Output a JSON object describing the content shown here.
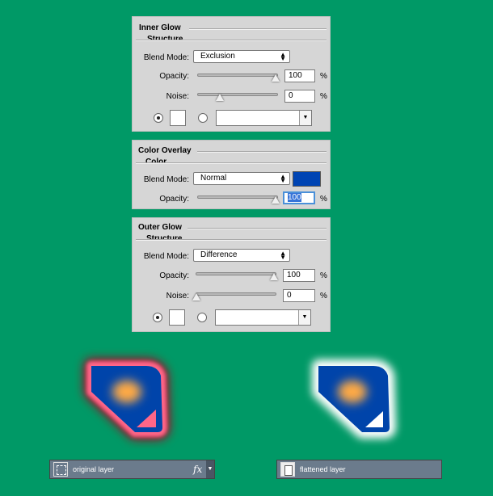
{
  "colors": {
    "background": "#009966",
    "overlay_swatch": "#0044b3",
    "shape_fill": "#0044aa",
    "shape_blob": "#ffaa44",
    "inner_glow_color": "#ffffff",
    "outer_glow_color": "#ffffff",
    "left_glow_pink": "#ff6688",
    "left_glow_dark": "#aa0022"
  },
  "inner_glow": {
    "title": "Inner Glow",
    "section": "Structure",
    "blend_label": "Blend Mode:",
    "blend_value": "Exclusion",
    "opacity_label": "Opacity:",
    "opacity_value": "100",
    "noise_label": "Noise:",
    "noise_value": "0",
    "percent": "%"
  },
  "color_overlay": {
    "title": "Color Overlay",
    "section": "Color",
    "blend_label": "Blend Mode:",
    "blend_value": "Normal",
    "opacity_label": "Opacity:",
    "opacity_value": "100",
    "percent": "%"
  },
  "outer_glow": {
    "title": "Outer Glow",
    "section": "Structure",
    "blend_label": "Blend Mode:",
    "blend_value": "Difference",
    "opacity_label": "Opacity:",
    "opacity_value": "100",
    "noise_label": "Noise:",
    "noise_value": "0",
    "percent": "%"
  },
  "layers": {
    "original": {
      "name": "original layer",
      "fx": "fx"
    },
    "flattened": {
      "name": "flattened layer"
    }
  }
}
